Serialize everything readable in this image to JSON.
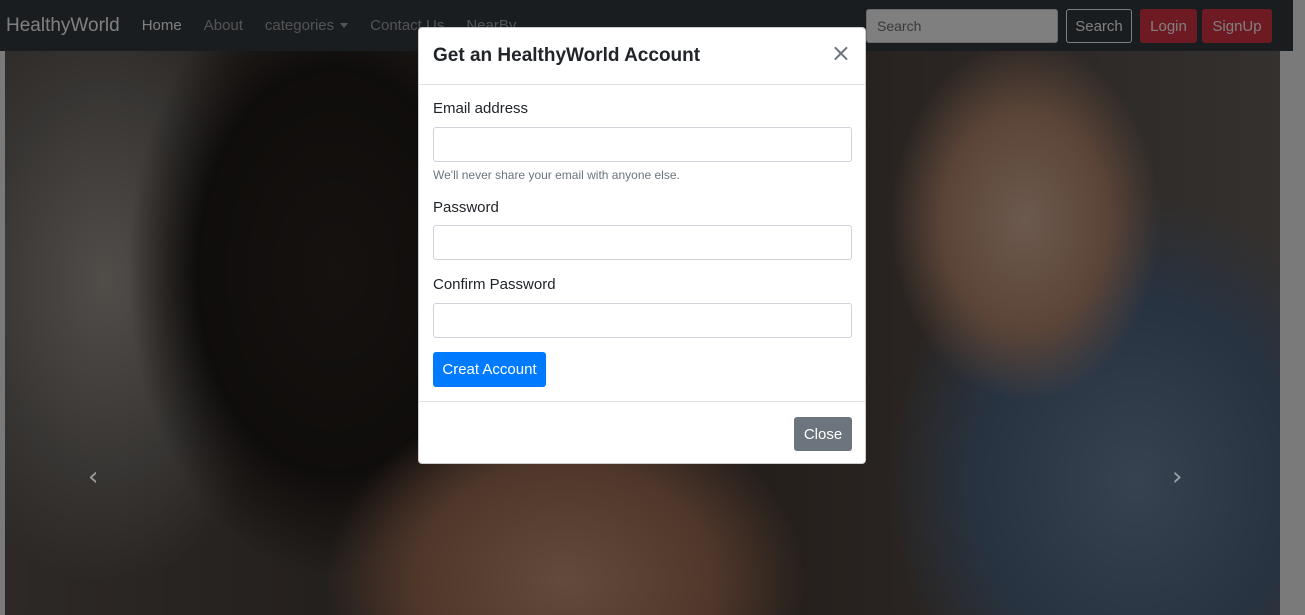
{
  "navbar": {
    "brand": "HealthyWorld",
    "links": [
      {
        "label": "Home",
        "active": true
      },
      {
        "label": "About",
        "active": false
      },
      {
        "label": "categories",
        "active": false
      },
      {
        "label": "Contact Us",
        "active": false
      },
      {
        "label": "NearBy",
        "active": false
      }
    ],
    "search_placeholder": "Search",
    "search_button": "Search",
    "login_button": "Login",
    "signup_button": "SignUp"
  },
  "carousel": {
    "prev_icon": "chevron-left-icon",
    "next_icon": "chevron-right-icon",
    "prev_glyph": "‹",
    "next_glyph": "›"
  },
  "modal": {
    "title": "Get an HealthyWorld Account",
    "close_glyph": "×",
    "email_label": "Email address",
    "email_value": "",
    "email_hint": "We'll never share your email with anyone else.",
    "password_label": "Password",
    "password_value": "",
    "confirm_label": "Confirm Password",
    "confirm_value": "",
    "submit_button": "Creat Account",
    "close_button": "Close"
  },
  "colors": {
    "navbar_bg": "#343a40",
    "danger": "#dc3545",
    "primary": "#007bff",
    "secondary": "#6c757d"
  }
}
